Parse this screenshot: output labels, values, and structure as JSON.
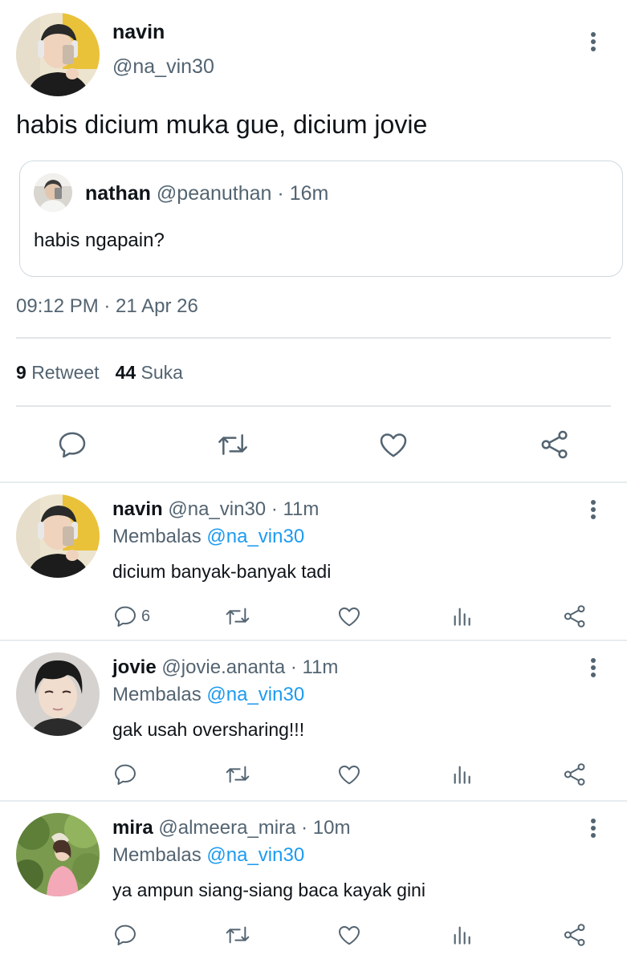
{
  "tweet": {
    "name": "navin",
    "handle": "@na_vin30",
    "text": "habis dicium muka gue, dicium jovie",
    "timestamp": "09:12 PM · 21 Apr 26",
    "retweet_count": "9",
    "retweet_label": "Retweet",
    "like_count": "44",
    "like_label": "Suka",
    "quote": {
      "name": "nathan",
      "handle": "@peanuthan",
      "time": "· 16m",
      "text": "habis ngapain?"
    }
  },
  "replies": [
    {
      "name": "navin",
      "handle": "@na_vin30",
      "time": "· 11m",
      "replying_label": "Membalas",
      "replying_to": "@na_vin30",
      "text": "dicium banyak-banyak tadi",
      "reply_count": "6"
    },
    {
      "name": "jovie",
      "handle": "@jovie.ananta",
      "time": "· 11m",
      "replying_label": "Membalas",
      "replying_to": "@na_vin30",
      "text": "gak usah oversharing!!!",
      "reply_count": ""
    },
    {
      "name": "mira",
      "handle": "@almeera_mira",
      "time": "· 10m",
      "replying_label": "Membalas",
      "replying_to": "@na_vin30",
      "text": "ya ampun siang-siang baca kayak gini",
      "reply_count": ""
    }
  ],
  "colors": {
    "text": "#0f1419",
    "secondary": "#536471",
    "link": "#1d9bf0",
    "border": "#cfd9de"
  },
  "icons": [
    "reply-icon",
    "retweet-icon",
    "like-icon",
    "share-icon",
    "analytics-icon",
    "more-icon"
  ]
}
